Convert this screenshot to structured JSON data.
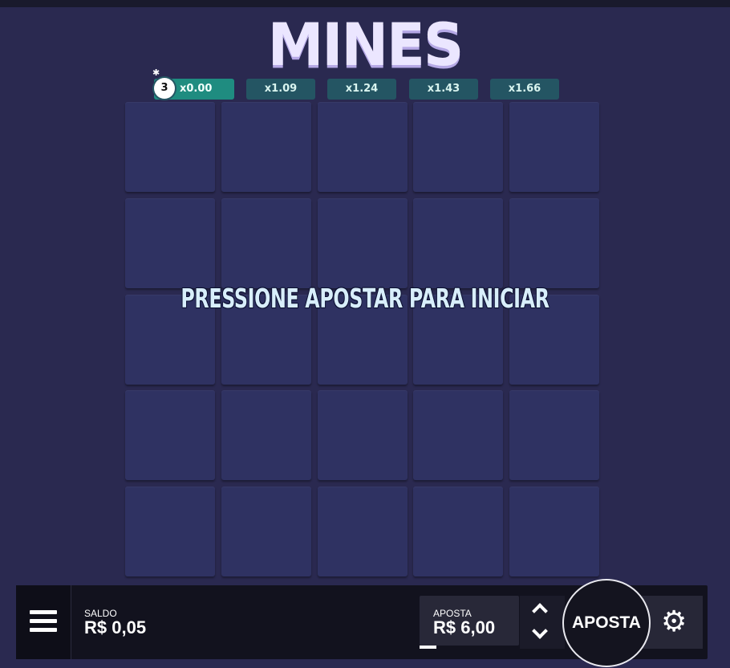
{
  "game": {
    "title": "MINES",
    "mines_count": "3",
    "multipliers": [
      "x0.00",
      "x1.09",
      "x1.24",
      "x1.43",
      "x1.66"
    ],
    "active_multiplier_index": 0,
    "start_message": "PRESSIONE APOSTAR PARA INICIAR",
    "grid": {
      "rows": 5,
      "cols": 5
    }
  },
  "footer": {
    "menu_icon": "hamburger-menu-icon",
    "balance_label": "SALDO",
    "balance_value": "R$ 0,05",
    "bet_label": "APOSTA",
    "bet_value": "R$ 6,00",
    "increase_icon": "chevron-up-icon",
    "decrease_icon": "chevron-down-icon",
    "bet_button_label": "APOSTA",
    "settings_icon": "gear-icon"
  },
  "colors": {
    "background": "#2a2950",
    "tile": "#2f3262",
    "multiplier": "#245563",
    "multiplier_active": "#1f8c80",
    "footer": "#12121e"
  }
}
